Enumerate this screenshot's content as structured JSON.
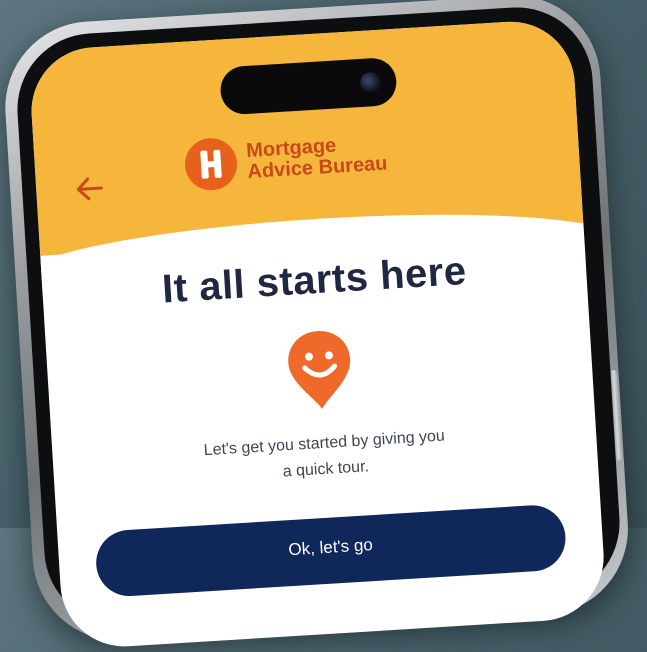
{
  "header": {
    "back_icon": "arrow-left-icon",
    "logo_line1": "Mortgage",
    "logo_line2": "Advice Bureau",
    "logo_icon": "mab-h-logo-icon",
    "background_color": "#f6b63c",
    "logo_color": "#e8611c"
  },
  "main": {
    "title": "It all starts here",
    "mascot_icon": "smiley-map-pin-icon",
    "mascot_color": "#ef6a2a",
    "subtitle_line1": "Let's get you started by giving you",
    "subtitle_line2": "a quick tour.",
    "cta_label": "Ok, let's go",
    "cta_color": "#10275a"
  }
}
